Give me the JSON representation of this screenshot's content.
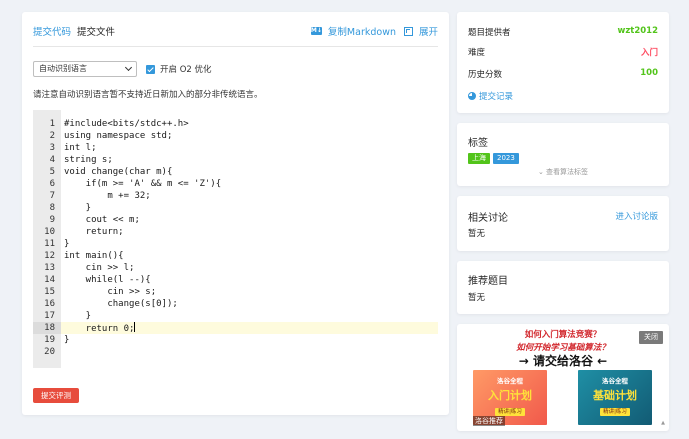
{
  "main": {
    "tabs": [
      "提交代码",
      "提交文件"
    ],
    "copy_markdown": "复制Markdown",
    "md_icon": "M↓",
    "expand": "展开",
    "language_select": "自动识别语言",
    "o2_label": "开启 O2 优化",
    "o2_checked": true,
    "notice": "请注意自动识别语言暂不支持近日新加入的部分非传统语言。",
    "code_lines": [
      "#include<bits/stdc++.h>",
      "using namespace std;",
      "int l;",
      "string s;",
      "void change(char m){",
      "    if(m >= 'A' && m <= 'Z'){",
      "        m += 32;",
      "    }",
      "    cout << m;",
      "    return;",
      "}",
      "int main(){",
      "    cin >> l;",
      "    while(l --){",
      "        cin >> s;",
      "        change(s[0]);",
      "    }",
      "    return 0;",
      "}",
      ""
    ],
    "active_line": 18,
    "submit": "提交评测"
  },
  "info": {
    "provider_label": "题目提供者",
    "provider_value": "wzt2012",
    "difficulty_label": "难度",
    "difficulty_value": "入门",
    "score_label": "历史分数",
    "score_value": "100",
    "history_link": "提交记录",
    "colors": {
      "provider": "#52c41a",
      "difficulty": "#fe4c61",
      "score": "#52c41a"
    }
  },
  "tags": {
    "title": "标签",
    "items": [
      {
        "label": "上海",
        "color": "#52c41a"
      },
      {
        "label": "2023",
        "color": "#3498db"
      }
    ],
    "more": "查看算法标签"
  },
  "discussion": {
    "title": "相关讨论",
    "link": "进入讨论版",
    "empty": "暂无"
  },
  "recommend": {
    "title": "推荐题目",
    "empty": "暂无"
  },
  "ad": {
    "line1": "如何入门算法竞赛？",
    "line2": "如何开始学习基础算法？",
    "line3": "请交给洛谷",
    "close": "关闭",
    "left_brand": "洛谷全程",
    "left_plan": "入门计划",
    "left_sub": "精讲|练习",
    "right_brand": "洛谷全程",
    "right_plan": "基础计划",
    "right_sub": "精讲|练习",
    "footer": "洛谷推荐"
  }
}
